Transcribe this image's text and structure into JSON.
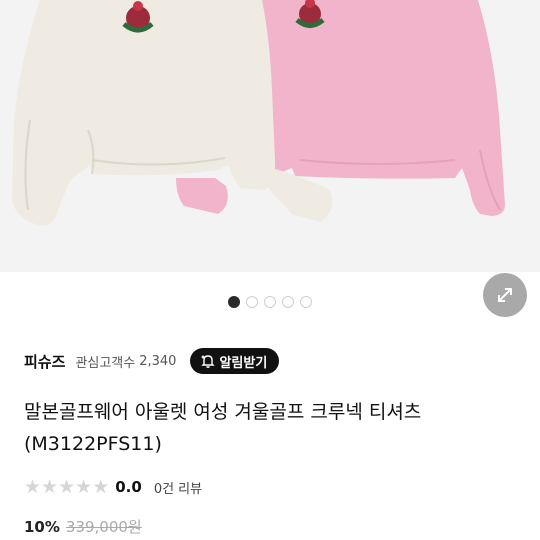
{
  "carousel": {
    "total": 5,
    "active_index": 0
  },
  "expand_icon": "expand-arrows-icon",
  "seller": {
    "name": "피슈즈",
    "followers_label": "관심고객수",
    "followers_count": "2,340",
    "alert_label": "알림받기",
    "alert_icon": "bell-plus-icon"
  },
  "product": {
    "title_line1": "말본골프웨어 아울렛 여성 겨울골프 크루넥 티셔츠",
    "title_line2": "(M3122PFS11)"
  },
  "rating": {
    "stars_filled": 0,
    "stars_total": 5,
    "value": "0.0",
    "reviews": "0건 리뷰"
  },
  "price": {
    "discount": "10%",
    "original": "339,000원"
  },
  "colors": {
    "cream_sweatshirt": "#efebe2",
    "pink_sweatshirt": "#f3b6cc",
    "background": "#f3f3f3"
  }
}
